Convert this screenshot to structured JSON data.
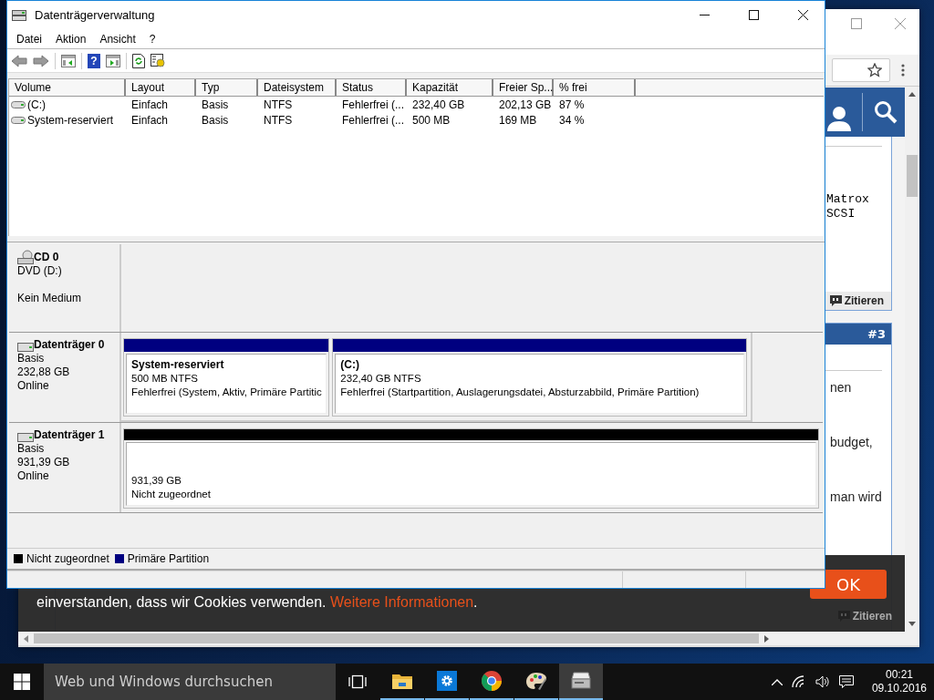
{
  "window": {
    "title": "Datenträgerverwaltung"
  },
  "menu": [
    "Datei",
    "Aktion",
    "Ansicht",
    "?"
  ],
  "toolbar": [
    {
      "kind": "back"
    },
    {
      "kind": "forward"
    },
    {
      "kind": "separator"
    },
    {
      "kind": "tree"
    },
    {
      "kind": "separator"
    },
    {
      "kind": "help",
      "glyph": "?"
    },
    {
      "kind": "pane"
    },
    {
      "kind": "separator"
    },
    {
      "kind": "refresh"
    },
    {
      "kind": "properties"
    }
  ],
  "volumes": {
    "columns": [
      "Volume",
      "Layout",
      "Typ",
      "Dateisystem",
      "Status",
      "Kapazität",
      "Freier Sp...",
      "% frei"
    ],
    "rows": [
      {
        "cells": [
          "(C:)",
          "Einfach",
          "Basis",
          "NTFS",
          "Fehlerfrei (...",
          "232,40 GB",
          "202,13 GB",
          "87 %"
        ]
      },
      {
        "cells": [
          "System-reserviert",
          "Einfach",
          "Basis",
          "NTFS",
          "Fehlerfrei (...",
          "500 MB",
          "169 MB",
          "34 %"
        ]
      }
    ]
  },
  "disks": [
    {
      "kind": "cd",
      "name": "CD 0",
      "type": "DVD (D:)",
      "status": "Kein Medium"
    },
    {
      "kind": "disk",
      "name": "Datenträger 0",
      "type": "Basis",
      "size": "232,88 GB",
      "status": "Online",
      "partitions": [
        {
          "name": "System-reserviert",
          "size": "500 MB NTFS",
          "status": "Fehlerfrei (System, Aktiv, Primäre Partitic",
          "color": "#000080"
        },
        {
          "name": "(C:)",
          "size": "232,40 GB NTFS",
          "status": "Fehlerfrei (Startpartition, Auslagerungsdatei, Absturzabbild, Primäre Partition)",
          "color": "#000080"
        }
      ]
    },
    {
      "kind": "disk",
      "name": "Datenträger 1",
      "type": "Basis",
      "size": "931,39 GB",
      "status": "Online",
      "partitions": [
        {
          "size": "931,39 GB",
          "status": "Nicht zugeordnet",
          "color": "#000000"
        }
      ]
    }
  ],
  "legend": [
    {
      "label": "Nicht zugeordnet",
      "color": "#000000"
    },
    {
      "label": "Primäre Partition",
      "color": "#000080"
    }
  ],
  "browser": {
    "posts": [
      {
        "text_lines": [
          "Matrox",
          "SCSI"
        ],
        "quote": "Zitieren"
      },
      {
        "number": "#3",
        "text_lines": [
          "nen",
          "budget,",
          "man wird"
        ],
        "quote": "Zitieren"
      }
    ],
    "cookie": {
      "text": "einverstanden, dass wir Cookies verwenden.",
      "link": "Weitere Informationen",
      "end": ".",
      "button": "OK"
    }
  },
  "taskbar": {
    "search": {
      "placeholder": "Web und Windows durchsuchen"
    },
    "apps": [
      {
        "kind": "taskview",
        "running": false,
        "selected": false
      },
      {
        "kind": "explorer",
        "running": true,
        "selected": false
      },
      {
        "kind": "settings",
        "running": true,
        "selected": false
      },
      {
        "kind": "chrome",
        "running": true,
        "selected": false
      },
      {
        "kind": "paint",
        "running": true,
        "selected": false
      },
      {
        "kind": "diskmgmt",
        "running": true,
        "selected": true
      }
    ],
    "time": "00:21",
    "date": "09.10.2016"
  }
}
